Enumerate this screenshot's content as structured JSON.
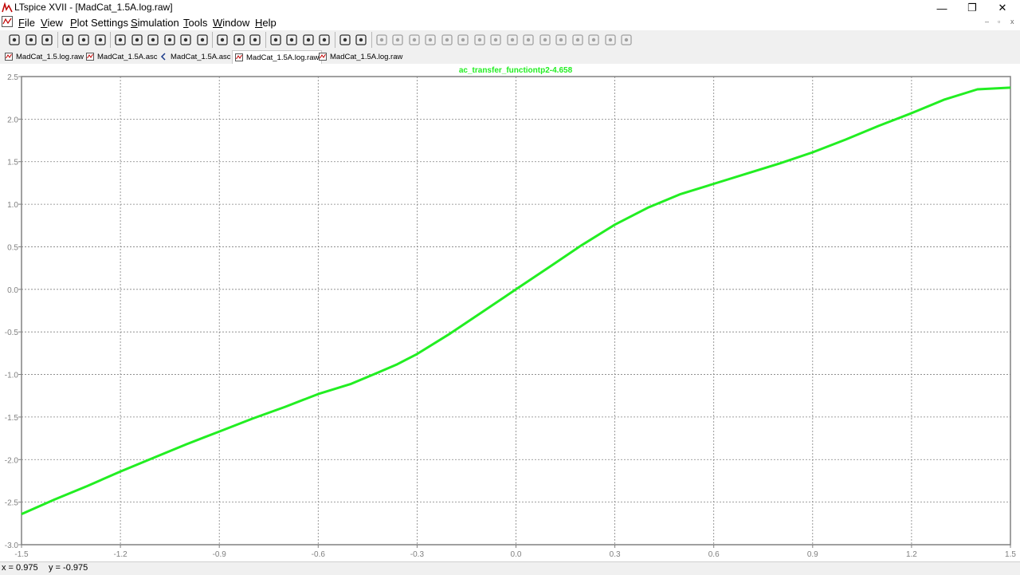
{
  "window": {
    "title": "LTspice XVII - [MadCat_1.5A.log.raw]",
    "controls": {
      "minimize": "—",
      "restore": "❐",
      "close": "✕"
    }
  },
  "menu": {
    "items": [
      "File",
      "View",
      "Plot Settings",
      "Simulation",
      "Tools",
      "Window",
      "Help"
    ],
    "mdi_controls": {
      "minimize": "–",
      "restore": "▫",
      "close": "x"
    }
  },
  "toolbar": {
    "icons": [
      "run-icon",
      "open-icon",
      "save-icon",
      "control-panel-icon",
      "halt-icon",
      "pan-icon",
      "zoom-in-icon",
      "zoom-area-icon",
      "zoom-out-icon",
      "zoom-fit-icon",
      "autorange-icon",
      "mark-icon",
      "tile-horizontal-icon",
      "tile-vertical-icon",
      "cascade-icon",
      "cut-icon",
      "copy-icon",
      "paste-icon",
      "find-icon",
      "print-icon",
      "print-preview-icon",
      "wire-icon",
      "ground-icon",
      "label-icon",
      "resistor-icon",
      "capacitor-icon",
      "inductor-icon",
      "diode-icon",
      "component-icon",
      "move-icon",
      "drag-icon",
      "undo-icon",
      "redo-icon",
      "rotate-icon",
      "mirror-icon",
      "text-icon",
      "spice-directive-icon"
    ]
  },
  "tabs": [
    {
      "label": "MadCat_1.5.log.raw",
      "icon": "waveform-icon",
      "active": false
    },
    {
      "label": "MadCat_1.5A.asc",
      "icon": "waveform-icon",
      "active": false
    },
    {
      "label": "MadCat_1.5A.asc",
      "icon": "schematic-icon",
      "active": false
    },
    {
      "label": "MadCat_1.5A.log.raw",
      "icon": "waveform-icon",
      "active": true
    },
    {
      "label": "MadCat_1.5A.log.raw",
      "icon": "waveform-icon",
      "active": false
    }
  ],
  "status": {
    "x": "x = 0.975",
    "y": "y = -0.975"
  },
  "colors": {
    "trace": "#22ee22",
    "grid": "#808080",
    "axis_text": "#808080"
  },
  "chart_data": {
    "type": "line",
    "title": "ac_transfer_functiontp2-4.658",
    "xlabel": "",
    "ylabel": "",
    "xlim": [
      -1.5,
      1.5
    ],
    "ylim": [
      -3.0,
      2.5
    ],
    "grid": true,
    "x_ticks": [
      "-1.5",
      "-1.2",
      "-0.9",
      "-0.6",
      "-0.3",
      "0.0",
      "0.3",
      "0.6",
      "0.9",
      "1.2",
      "1.5"
    ],
    "y_ticks": [
      "2.5",
      "2.0",
      "1.5",
      "1.0",
      "0.5",
      "0.0",
      "-0.5",
      "-1.0",
      "-1.5",
      "-2.0",
      "-2.5",
      "-3.0"
    ],
    "series": [
      {
        "name": "ac_transfer_functiontp2-4.658",
        "color": "#22ee22",
        "x": [
          -1.5,
          -1.4,
          -1.3,
          -1.2,
          -1.1,
          -1.0,
          -0.9,
          -0.8,
          -0.7,
          -0.6,
          -0.5,
          -0.42,
          -0.36,
          -0.3,
          -0.2,
          -0.1,
          0.0,
          0.1,
          0.2,
          0.3,
          0.4,
          0.5,
          0.6,
          0.7,
          0.8,
          0.9,
          1.0,
          1.1,
          1.2,
          1.3,
          1.4,
          1.5
        ],
        "y": [
          -2.64,
          -2.47,
          -2.31,
          -2.14,
          -1.98,
          -1.82,
          -1.67,
          -1.52,
          -1.38,
          -1.23,
          -1.11,
          -0.98,
          -0.88,
          -0.76,
          -0.52,
          -0.26,
          0.0,
          0.26,
          0.52,
          0.76,
          0.96,
          1.12,
          1.24,
          1.36,
          1.48,
          1.61,
          1.76,
          1.92,
          2.07,
          2.23,
          2.35,
          2.37
        ]
      }
    ]
  }
}
